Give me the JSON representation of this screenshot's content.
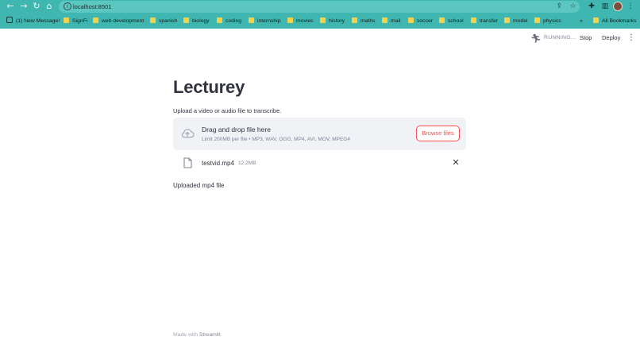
{
  "browser": {
    "url": "localhost:8501",
    "bookmarks": [
      {
        "label": "(1) New Message!",
        "kind": "site"
      },
      {
        "label": "SignFi",
        "kind": "folder"
      },
      {
        "label": "web development",
        "kind": "folder"
      },
      {
        "label": "spanish",
        "kind": "folder"
      },
      {
        "label": "biology",
        "kind": "folder"
      },
      {
        "label": "coding",
        "kind": "folder"
      },
      {
        "label": "internship",
        "kind": "folder"
      },
      {
        "label": "movies",
        "kind": "folder"
      },
      {
        "label": "history",
        "kind": "folder"
      },
      {
        "label": "maths",
        "kind": "folder"
      },
      {
        "label": "mail",
        "kind": "folder"
      },
      {
        "label": "soccer",
        "kind": "folder"
      },
      {
        "label": "school",
        "kind": "folder"
      },
      {
        "label": "transfer",
        "kind": "folder"
      },
      {
        "label": "model",
        "kind": "folder"
      },
      {
        "label": "physics",
        "kind": "folder"
      }
    ],
    "overflow_glyph": "»",
    "all_bookmarks": "All Bookmarks",
    "accent_color": "#3fb6b0"
  },
  "app_toolbar": {
    "status": "RUNNING...",
    "stop_label": "Stop",
    "deploy_label": "Deploy"
  },
  "main": {
    "title": "Lecturey",
    "uploader_label": "Upload a video or audio file to transcribe.",
    "dropzone": {
      "title": "Drag and drop file here",
      "limit": "Limit 200MB per file • MP3, WAV, OGG, MP4, AVI, MOV, MPEG4",
      "browse_label": "Browse files"
    },
    "file": {
      "name": "testvid.mp4",
      "size": "12.2MB"
    },
    "status": "Uploaded mp4 file"
  },
  "footer": {
    "prefix": "Made with",
    "brand": "Streamlit"
  },
  "colors": {
    "primary": "#ff4b4b",
    "text": "#31333f",
    "muted": "#808495",
    "dropzone_bg": "#f0f2f6"
  }
}
